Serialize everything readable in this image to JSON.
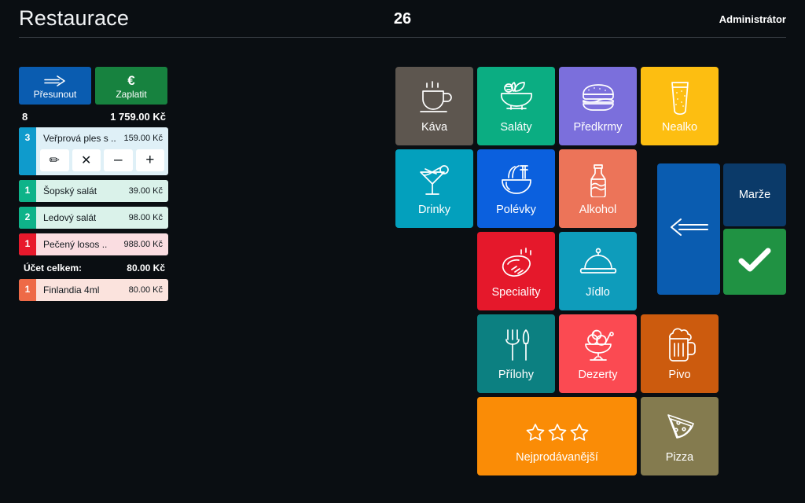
{
  "header": {
    "title": "Restaurace",
    "table_number": "26",
    "user": "Administrátor"
  },
  "order_panel": {
    "move_button": {
      "label": "Přesunout",
      "icon": "arrow-right-icon",
      "color": "#0a5cb0"
    },
    "pay_button": {
      "label": "Zaplatit",
      "icon": "euro-icon",
      "color": "#17823f"
    },
    "item_count": "8",
    "order_total": "1 759.00 Kč",
    "bill_total_label": "Účet celkem:",
    "bill_total_value": "80.00 Kč",
    "row_actions": {
      "edit": "✏",
      "delete": "✕",
      "decrease": "–",
      "increase": "+"
    },
    "items": [
      {
        "qty": "3",
        "name": "Veřprová ples s ..",
        "price": "159.00 Kč",
        "badge_color": "#0f9bcc",
        "row_color": "#dff0f7",
        "expanded": true
      },
      {
        "qty": "1",
        "name": "Šopský salát",
        "price": "39.00 Kč",
        "badge_color": "#0eb389",
        "row_color": "#daf2ea",
        "expanded": false
      },
      {
        "qty": "2",
        "name": "Ledový salát",
        "price": "98.00 Kč",
        "badge_color": "#0eb389",
        "row_color": "#daf2ea",
        "expanded": false
      },
      {
        "qty": "1",
        "name": "Pečený losos ..",
        "price": "988.00 Kč",
        "badge_color": "#e8192c",
        "row_color": "#fadde1",
        "expanded": false
      },
      {
        "qty": "1",
        "name": "Finlandia 4ml",
        "price": "80.00 Kč",
        "badge_color": "#ee6a47",
        "row_color": "#fbe3dd",
        "expanded": false
      }
    ]
  },
  "category_tiles": [
    {
      "label": "Káva",
      "icon": "coffee-cup-icon",
      "color": "#5d564f",
      "col": 1,
      "row": 1,
      "wide": false
    },
    {
      "label": "Saláty",
      "icon": "salad-bowl-icon",
      "color": "#0bad82",
      "col": 2,
      "row": 1,
      "wide": false
    },
    {
      "label": "Předkrmy",
      "icon": "burger-icon",
      "color": "#7b6fdc",
      "col": 3,
      "row": 1,
      "wide": false
    },
    {
      "label": "Nealko",
      "icon": "soda-glass-icon",
      "color": "#fdbe11",
      "col": 4,
      "row": 1,
      "wide": false
    },
    {
      "label": "Drinky",
      "icon": "cocktail-icon",
      "color": "#03a0bd",
      "col": 1,
      "row": 2,
      "wide": false
    },
    {
      "label": "Polévky",
      "icon": "noodle-bowl-icon",
      "color": "#0b60de",
      "col": 2,
      "row": 2,
      "wide": false
    },
    {
      "label": "Alkohol",
      "icon": "bottle-icon",
      "color": "#ec7459",
      "col": 3,
      "row": 2,
      "wide": false
    },
    {
      "label": "Speciality",
      "icon": "steak-icon",
      "color": "#e5182b",
      "col": 2,
      "row": 3,
      "wide": false
    },
    {
      "label": "Jídlo",
      "icon": "cloche-icon",
      "color": "#0e9cbb",
      "col": 3,
      "row": 3,
      "wide": false
    },
    {
      "label": "Přílohy",
      "icon": "fork-knife-icon",
      "color": "#0c8081",
      "col": 2,
      "row": 4,
      "wide": false
    },
    {
      "label": "Dezerty",
      "icon": "ice-cream-icon",
      "color": "#fb4a52",
      "col": 3,
      "row": 4,
      "wide": false
    },
    {
      "label": "Pivo",
      "icon": "beer-mug-icon",
      "color": "#cc5b0e",
      "col": 4,
      "row": 4,
      "wide": false
    },
    {
      "label": "Nejprodávanější",
      "icon": "three-stars-icon",
      "color": "#fa8c06",
      "col": 2,
      "row": 5,
      "wide": true
    },
    {
      "label": "Pizza",
      "icon": "pizza-slice-icon",
      "color": "#847b4f",
      "col": 4,
      "row": 5,
      "wide": false
    }
  ],
  "controls": {
    "back_button": {
      "icon": "arrow-left-icon",
      "color": "#0a5cb0"
    },
    "margin_button": {
      "label": "Marže",
      "color": "#0b3a69"
    },
    "confirm_button": {
      "icon": "check-icon",
      "color": "#209243"
    }
  }
}
